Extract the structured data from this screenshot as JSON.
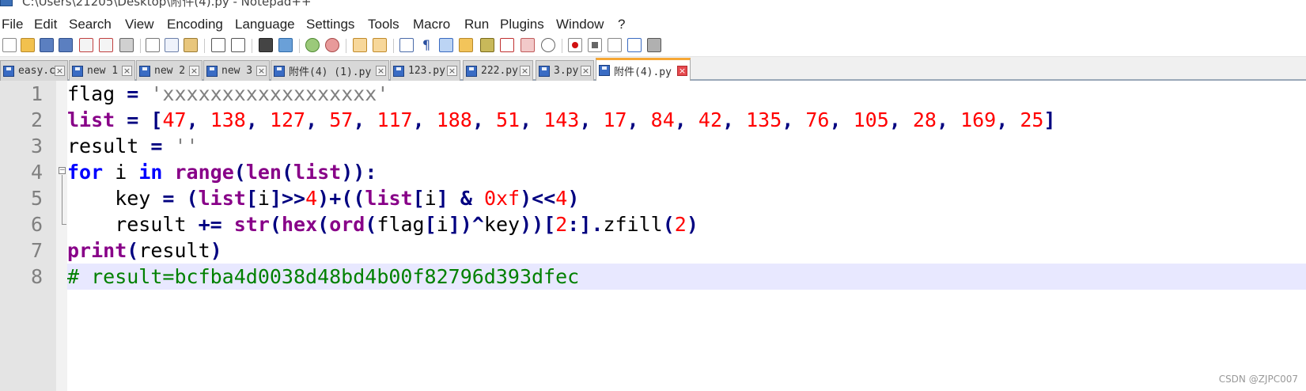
{
  "window": {
    "title": "C:\\Users\\21205\\Desktop\\附件(4).py - Notepad++"
  },
  "menu": [
    "File",
    "Edit",
    "Search",
    "View",
    "Encoding",
    "Language",
    "Settings",
    "Tools",
    "Macro",
    "Run",
    "Plugins",
    "Window",
    "?"
  ],
  "toolbar": {
    "icons": [
      "new-file-icon",
      "open-file-icon",
      "save-icon",
      "save-all-icon",
      "close-icon",
      "close-all-icon",
      "print-icon",
      "cut-icon",
      "copy-icon",
      "paste-icon",
      "undo-icon",
      "redo-icon",
      "find-icon",
      "replace-icon",
      "zoom-in-icon",
      "zoom-out-icon",
      "sync-vertical-icon",
      "sync-horizontal-icon",
      "word-wrap-icon",
      "show-all-chars-icon",
      "indent-guide-icon",
      "user-language-icon",
      "document-map-icon",
      "function-list-icon",
      "folder-workspace-icon",
      "monitoring-icon",
      "record-macro-icon",
      "stop-recording-icon",
      "playback-macro-icon",
      "run-macro-multiple-icon",
      "save-macro-icon"
    ]
  },
  "tabs": [
    {
      "label": "easy.c",
      "active": false
    },
    {
      "label": "new 1",
      "active": false
    },
    {
      "label": "new 2",
      "active": false
    },
    {
      "label": "new 3",
      "active": false
    },
    {
      "label": "附件(4) (1).py",
      "active": false
    },
    {
      "label": "123.py",
      "active": false
    },
    {
      "label": "222.py",
      "active": false
    },
    {
      "label": "3.py",
      "active": false
    },
    {
      "label": "附件(4).py",
      "active": true
    }
  ],
  "editor": {
    "line_numbers": [
      "1",
      "2",
      "3",
      "4",
      "5",
      "6",
      "7",
      "8"
    ],
    "current_line": 8,
    "lines": [
      [
        {
          "t": "flag ",
          "c": ""
        },
        {
          "t": "=",
          "c": "op"
        },
        {
          "t": " 'xxxxxxxxxxxxxxxxxx'",
          "c": "str"
        }
      ],
      [
        {
          "t": "list",
          "c": "bi"
        },
        {
          "t": " ",
          "c": ""
        },
        {
          "t": "=",
          "c": "op"
        },
        {
          "t": " ",
          "c": ""
        },
        {
          "t": "[",
          "c": "op"
        },
        {
          "t": "47",
          "c": "num"
        },
        {
          "t": ", ",
          "c": "op"
        },
        {
          "t": "138",
          "c": "num"
        },
        {
          "t": ", ",
          "c": "op"
        },
        {
          "t": "127",
          "c": "num"
        },
        {
          "t": ", ",
          "c": "op"
        },
        {
          "t": "57",
          "c": "num"
        },
        {
          "t": ", ",
          "c": "op"
        },
        {
          "t": "117",
          "c": "num"
        },
        {
          "t": ", ",
          "c": "op"
        },
        {
          "t": "188",
          "c": "num"
        },
        {
          "t": ", ",
          "c": "op"
        },
        {
          "t": "51",
          "c": "num"
        },
        {
          "t": ", ",
          "c": "op"
        },
        {
          "t": "143",
          "c": "num"
        },
        {
          "t": ", ",
          "c": "op"
        },
        {
          "t": "17",
          "c": "num"
        },
        {
          "t": ", ",
          "c": "op"
        },
        {
          "t": "84",
          "c": "num"
        },
        {
          "t": ", ",
          "c": "op"
        },
        {
          "t": "42",
          "c": "num"
        },
        {
          "t": ", ",
          "c": "op"
        },
        {
          "t": "135",
          "c": "num"
        },
        {
          "t": ", ",
          "c": "op"
        },
        {
          "t": "76",
          "c": "num"
        },
        {
          "t": ", ",
          "c": "op"
        },
        {
          "t": "105",
          "c": "num"
        },
        {
          "t": ", ",
          "c": "op"
        },
        {
          "t": "28",
          "c": "num"
        },
        {
          "t": ", ",
          "c": "op"
        },
        {
          "t": "169",
          "c": "num"
        },
        {
          "t": ", ",
          "c": "op"
        },
        {
          "t": "25",
          "c": "num"
        },
        {
          "t": "]",
          "c": "op"
        }
      ],
      [
        {
          "t": "result ",
          "c": ""
        },
        {
          "t": "=",
          "c": "op"
        },
        {
          "t": " ''",
          "c": "str"
        }
      ],
      [
        {
          "t": "for",
          "c": "kw"
        },
        {
          "t": " i ",
          "c": ""
        },
        {
          "t": "in",
          "c": "kw"
        },
        {
          "t": " ",
          "c": ""
        },
        {
          "t": "range",
          "c": "bi"
        },
        {
          "t": "(",
          "c": "op"
        },
        {
          "t": "len",
          "c": "bi"
        },
        {
          "t": "(",
          "c": "op"
        },
        {
          "t": "list",
          "c": "bi"
        },
        {
          "t": ")):",
          "c": "op"
        }
      ],
      [
        {
          "t": "    key ",
          "c": ""
        },
        {
          "t": "=",
          "c": "op"
        },
        {
          "t": " ",
          "c": ""
        },
        {
          "t": "(",
          "c": "op"
        },
        {
          "t": "list",
          "c": "bi"
        },
        {
          "t": "[",
          "c": "op"
        },
        {
          "t": "i",
          "c": ""
        },
        {
          "t": "]>>",
          "c": "op"
        },
        {
          "t": "4",
          "c": "num"
        },
        {
          "t": ")+((",
          "c": "op"
        },
        {
          "t": "list",
          "c": "bi"
        },
        {
          "t": "[",
          "c": "op"
        },
        {
          "t": "i",
          "c": ""
        },
        {
          "t": "] & ",
          "c": "op"
        },
        {
          "t": "0xf",
          "c": "num"
        },
        {
          "t": ")<<",
          "c": "op"
        },
        {
          "t": "4",
          "c": "num"
        },
        {
          "t": ")",
          "c": "op"
        }
      ],
      [
        {
          "t": "    result ",
          "c": ""
        },
        {
          "t": "+=",
          "c": "op"
        },
        {
          "t": " ",
          "c": ""
        },
        {
          "t": "str",
          "c": "bi"
        },
        {
          "t": "(",
          "c": "op"
        },
        {
          "t": "hex",
          "c": "bi"
        },
        {
          "t": "(",
          "c": "op"
        },
        {
          "t": "ord",
          "c": "bi"
        },
        {
          "t": "(",
          "c": "op"
        },
        {
          "t": "flag",
          "c": ""
        },
        {
          "t": "[",
          "c": "op"
        },
        {
          "t": "i",
          "c": ""
        },
        {
          "t": "])^",
          "c": "op"
        },
        {
          "t": "key",
          "c": ""
        },
        {
          "t": "))[",
          "c": "op"
        },
        {
          "t": "2",
          "c": "num"
        },
        {
          "t": ":].",
          "c": "op"
        },
        {
          "t": "zfill",
          "c": ""
        },
        {
          "t": "(",
          "c": "op"
        },
        {
          "t": "2",
          "c": "num"
        },
        {
          "t": ")",
          "c": "op"
        }
      ],
      [
        {
          "t": "print",
          "c": "bi"
        },
        {
          "t": "(",
          "c": "op"
        },
        {
          "t": "result",
          "c": ""
        },
        {
          "t": ")",
          "c": "op"
        }
      ],
      [
        {
          "t": "# result=bcfba4d0038d48bd4b00f82796d393dfec",
          "c": "cmt"
        }
      ]
    ]
  },
  "watermark": "CSDN @ZJPC007",
  "colors": {
    "keyword": "#0000ff",
    "builtin": "#880088",
    "number": "#ff0000",
    "string": "#808080",
    "operator": "#000080",
    "comment": "#008000",
    "current_line_bg": "#e8e8ff",
    "active_tab_accent": "#f6a735"
  }
}
